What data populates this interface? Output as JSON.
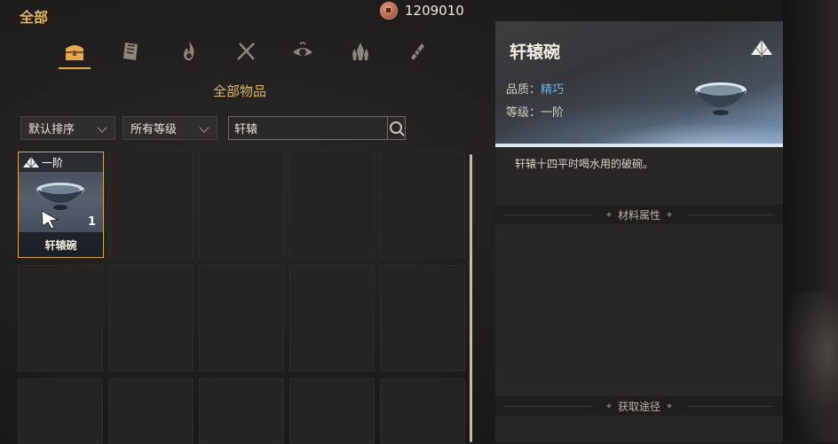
{
  "header": {
    "category_title": "全部",
    "currency_value": "1209010",
    "currency_icon": "copper-coin-icon"
  },
  "tabs": [
    {
      "icon": "chest-icon",
      "active": true
    },
    {
      "icon": "book-icon",
      "active": false
    },
    {
      "icon": "flame-icon",
      "active": false
    },
    {
      "icon": "crossed-weapons-icon",
      "active": false
    },
    {
      "icon": "eye-icon",
      "active": false
    },
    {
      "icon": "crystal-icon",
      "active": false
    },
    {
      "icon": "scroll-icon",
      "active": false
    }
  ],
  "inventory": {
    "section_title": "全部物品",
    "sort_label": "默认排序",
    "grade_filter_label": "所有等级",
    "search_value": "轩辕",
    "items": [
      {
        "grade": "一阶",
        "name": "轩辕碗",
        "quantity": "1"
      }
    ]
  },
  "detail": {
    "title": "轩辕碗",
    "quality_label": "品质：",
    "quality_value": "精巧",
    "grade_label": "等级：",
    "grade_value": "一阶",
    "description": "轩辕十四平时喝水用的破碗。",
    "section_attributes": "材料属性",
    "section_source": "获取途径"
  },
  "colors": {
    "accent_gold": "#e0b45a",
    "quality_blue": "#5fb4f0",
    "selected_border": "#d7a648"
  }
}
